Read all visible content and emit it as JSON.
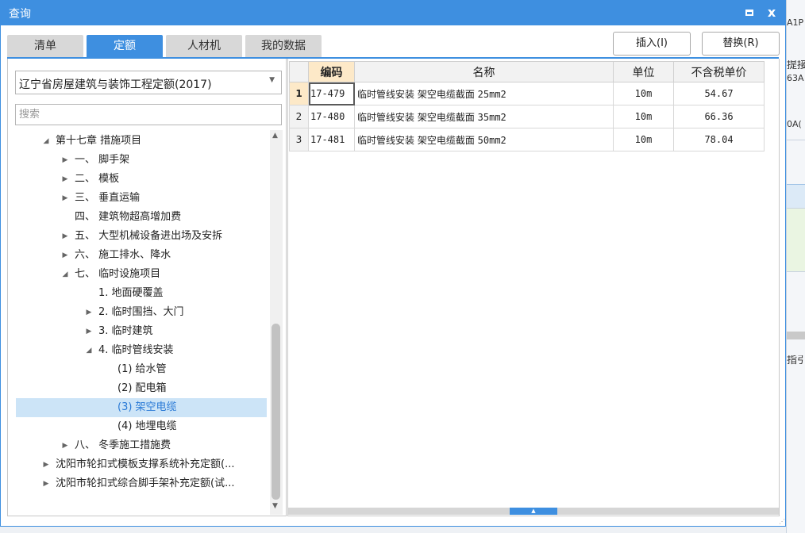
{
  "window": {
    "title": "查询",
    "maximize_icon": "maximize-icon",
    "close_label": "x"
  },
  "tabs": [
    {
      "label": "清单",
      "active": false
    },
    {
      "label": "定额",
      "active": true
    },
    {
      "label": "人材机",
      "active": false
    },
    {
      "label": "我的数据",
      "active": false
    }
  ],
  "actions": {
    "insert_label": "插入(I)",
    "replace_label": "替换(R)"
  },
  "left": {
    "library_selected": "辽宁省房屋建筑与装饰工程定额(2017)",
    "search_placeholder": "搜索",
    "tree": [
      {
        "label": "第十七章 措施项目",
        "arrow": "◢",
        "selected": false
      },
      {
        "label": "一、 脚手架",
        "arrow": "▶",
        "selected": false
      },
      {
        "label": "二、 模板",
        "arrow": "▶",
        "selected": false
      },
      {
        "label": "三、 垂直运输",
        "arrow": "▶",
        "selected": false
      },
      {
        "label": "四、 建筑物超高增加费",
        "arrow": "",
        "selected": false
      },
      {
        "label": "五、 大型机械设备进出场及安拆",
        "arrow": "▶",
        "selected": false
      },
      {
        "label": "六、 施工排水、降水",
        "arrow": "▶",
        "selected": false
      },
      {
        "label": "七、 临时设施项目",
        "arrow": "◢",
        "selected": false
      },
      {
        "label": "1. 地面硬覆盖",
        "arrow": "",
        "selected": false
      },
      {
        "label": "2. 临时围挡、大门",
        "arrow": "▶",
        "selected": false
      },
      {
        "label": "3. 临时建筑",
        "arrow": "▶",
        "selected": false
      },
      {
        "label": "4. 临时管线安装",
        "arrow": "◢",
        "selected": false
      },
      {
        "label": "(1) 给水管",
        "arrow": "",
        "selected": false
      },
      {
        "label": "(2) 配电箱",
        "arrow": "",
        "selected": false
      },
      {
        "label": "(3) 架空电缆",
        "arrow": "",
        "selected": true
      },
      {
        "label": "(4) 地埋电缆",
        "arrow": "",
        "selected": false
      },
      {
        "label": "八、 冬季施工措施费",
        "arrow": "▶",
        "selected": false
      },
      {
        "label": "沈阳市轮扣式模板支撑系统补充定额(...",
        "arrow": "▶",
        "selected": false
      },
      {
        "label": "沈阳市轮扣式综合脚手架补充定额(试...",
        "arrow": "▶",
        "selected": false
      }
    ]
  },
  "grid": {
    "headers": {
      "code": "编码",
      "name": "名称",
      "unit": "单位",
      "price": "不含税单价"
    },
    "rows": [
      {
        "num": "1",
        "code": "17-479",
        "name_text": "临时管线安装 架空电缆截面 ",
        "name_size": "25mm2",
        "unit": "10m",
        "price": "54.67"
      },
      {
        "num": "2",
        "code": "17-480",
        "name_text": "临时管线安装 架空电缆截面 ",
        "name_size": "35mm2",
        "unit": "10m",
        "price": "66.36"
      },
      {
        "num": "3",
        "code": "17-481",
        "name_text": "临时管线安装 架空电缆截面 ",
        "name_size": "50mm2",
        "unit": "10m",
        "price": "78.04"
      }
    ]
  },
  "background_app": {
    "fragments": [
      "A1P",
      "提接",
      "63A",
      "0A(",
      "指引"
    ]
  },
  "colors": {
    "accent": "#3e8fe0",
    "selected_row_bg": "#cce4f7",
    "header_highlight": "#fde9c8"
  }
}
